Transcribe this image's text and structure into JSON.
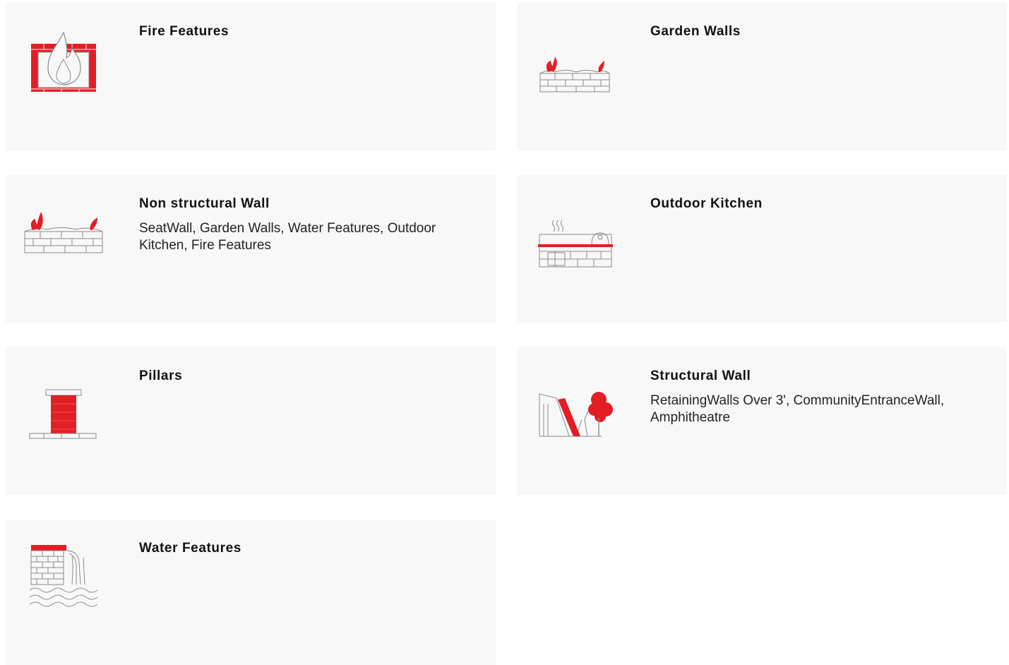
{
  "colors": {
    "accent": "#e31e24",
    "card_bg": "#f8f8f8",
    "line": "#8a8a8a"
  },
  "cards": [
    {
      "title": "Fire Features",
      "description": "",
      "icon": "fire-pit-icon"
    },
    {
      "title": "Garden Walls",
      "description": "",
      "icon": "garden-wall-icon"
    },
    {
      "title": "Non structural Wall",
      "description": "SeatWall, Garden Walls, Water Features, Outdoor Kitchen, Fire Features",
      "icon": "seat-wall-icon"
    },
    {
      "title": "Outdoor Kitchen",
      "description": "",
      "icon": "outdoor-kitchen-icon"
    },
    {
      "title": "Pillars",
      "description": "",
      "icon": "pillar-icon"
    },
    {
      "title": "Structural Wall",
      "description": "RetainingWalls Over 3', CommunityEntranceWall, Amphitheatre",
      "icon": "retaining-wall-icon"
    },
    {
      "title": "Water Features",
      "description": "",
      "icon": "waterfall-wall-icon"
    }
  ]
}
